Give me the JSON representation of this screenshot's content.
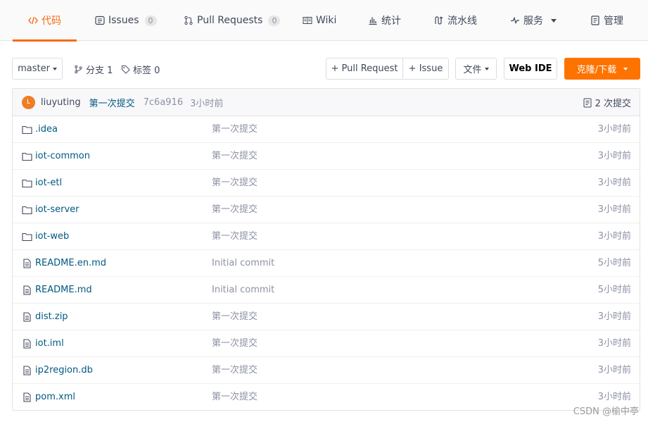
{
  "tabs": [
    {
      "label": "代码",
      "icon": "code-icon",
      "active": true
    },
    {
      "label": "Issues",
      "icon": "issues-icon",
      "count": "0"
    },
    {
      "label": "Pull Requests",
      "icon": "pull-request-icon",
      "count": "0"
    },
    {
      "label": "Wiki",
      "icon": "wiki-icon"
    },
    {
      "label": "统计",
      "icon": "chart-icon"
    },
    {
      "label": "流水线",
      "icon": "pipeline-icon"
    },
    {
      "label": "服务",
      "icon": "pulse-icon"
    },
    {
      "label": "管理",
      "icon": "manage-icon"
    }
  ],
  "toolbar": {
    "branch": "master",
    "branches_label": "分支 1",
    "tags_label": "标签 0",
    "pull_request": "+ Pull Request",
    "issue": "+ Issue",
    "files": "文件",
    "web_ide": "Web IDE",
    "clone": "克隆/下载"
  },
  "latest_commit": {
    "avatar_letter": "L",
    "author": "liuyuting",
    "message": "第一次提交",
    "sha": "7c6a916",
    "time": "3小时前",
    "count_label": "2 次提交"
  },
  "files": [
    {
      "name": ".idea",
      "type": "folder",
      "message": "第一次提交",
      "time": "3小时前"
    },
    {
      "name": "iot-common",
      "type": "folder",
      "message": "第一次提交",
      "time": "3小时前"
    },
    {
      "name": "iot-etl",
      "type": "folder",
      "message": "第一次提交",
      "time": "3小时前"
    },
    {
      "name": "iot-server",
      "type": "folder",
      "message": "第一次提交",
      "time": "3小时前"
    },
    {
      "name": "iot-web",
      "type": "folder",
      "message": "第一次提交",
      "time": "3小时前"
    },
    {
      "name": "README.en.md",
      "type": "file",
      "message": "Initial commit",
      "time": "5小时前"
    },
    {
      "name": "README.md",
      "type": "file",
      "message": "Initial commit",
      "time": "5小时前"
    },
    {
      "name": "dist.zip",
      "type": "file",
      "message": "第一次提交",
      "time": "3小时前"
    },
    {
      "name": "iot.iml",
      "type": "file",
      "message": "第一次提交",
      "time": "3小时前"
    },
    {
      "name": "ip2region.db",
      "type": "file",
      "message": "第一次提交",
      "time": "3小时前"
    },
    {
      "name": "pom.xml",
      "type": "file",
      "message": "第一次提交",
      "time": "3小时前"
    }
  ],
  "watermark": "CSDN @榆中亭",
  "colors": {
    "accent": "#f86b16",
    "clone_button": "#fe7300",
    "link": "#005980",
    "muted": "#8c92a4"
  }
}
